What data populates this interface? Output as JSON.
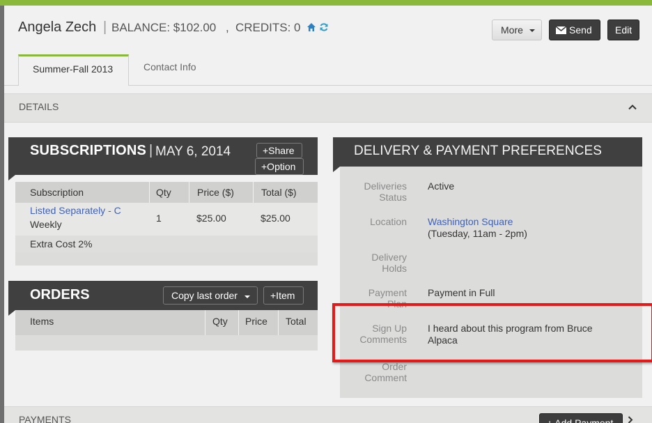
{
  "header": {
    "name": "Angela Zech",
    "separator": "|",
    "balance": "BALANCE: $102.00",
    "comma": ",",
    "credits": "CREDITS: 0",
    "icons": [
      "home-icon",
      "refresh-icon"
    ],
    "more_label": "More",
    "send_label": "Send",
    "edit_label": "Edit"
  },
  "tabs": [
    {
      "label": "Summer-Fall 2013",
      "active": true
    },
    {
      "label": "Contact Info",
      "active": false
    }
  ],
  "details": {
    "label": "DETAILS"
  },
  "subscriptions": {
    "title": "SUBSCRIPTIONS",
    "separator": "|",
    "date": "MAY 6, 2014",
    "share_label": "+Share",
    "option_label": "+Option",
    "columns": [
      "Subscription",
      "Qty",
      "Price ($)",
      "Total ($)"
    ],
    "rows": [
      {
        "name": "Listed Separately - C",
        "frequency": "Weekly",
        "qty": "1",
        "price": "$25.00",
        "total": "$25.00"
      }
    ],
    "extra": "Extra Cost 2%"
  },
  "orders": {
    "title": "ORDERS",
    "copy_label": "Copy last order",
    "item_label": "+Item",
    "columns": [
      "Items",
      "Qty",
      "Price",
      "Total"
    ]
  },
  "delivery_payment": {
    "title": "DELIVERY & PAYMENT PREFERENCES",
    "fields": [
      {
        "label_1": "Deliveries",
        "label_2": "Status",
        "value_1": "Active",
        "value_2": ""
      },
      {
        "label_1": "Location",
        "label_2": "",
        "value_1": "Washington Square",
        "value_2": "(Tuesday, 11am - 2pm)"
      },
      {
        "label_1": "Delivery",
        "label_2": "Holds",
        "value_1": "",
        "value_2": ""
      },
      {
        "label_1": "Payment",
        "label_2": "Plan",
        "value_1": "Payment in Full",
        "value_2": ""
      },
      {
        "label_1": "Sign Up",
        "label_2": "Comments",
        "value_1": "I heard about this program from Bruce",
        "value_2": "Alpaca"
      },
      {
        "label_1": "Order",
        "label_2": "Comment",
        "value_1": "",
        "value_2": ""
      }
    ]
  },
  "payments": {
    "label": "PAYMENTS",
    "add_label": "+ Add Payment"
  },
  "colors": {
    "accent": "#8ab83b",
    "dark": "#404040",
    "link": "#3f61b8",
    "highlight": "#e61818"
  }
}
